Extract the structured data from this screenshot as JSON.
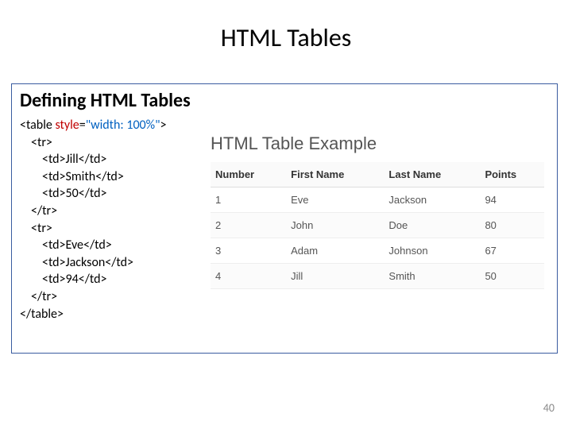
{
  "title": "HTML Tables",
  "section_heading": "Defining HTML Tables",
  "code": {
    "l1a": "<table ",
    "l1_attr": "style",
    "l1_eq": "=",
    "l1_val": "\"width: 100%\"",
    "l1b": ">",
    "l2": "<tr>",
    "l3": "<td>Jill</td>",
    "l4": "<td>Smith</td>",
    "l5": "<td>50</td>",
    "l6": "</tr>",
    "l7": "<tr>",
    "l8": "<td>Eve</td>",
    "l9": "<td>Jackson</td>",
    "l10": "<td>94</td>",
    "l11": "</tr>",
    "l12": "</table>"
  },
  "example": {
    "title": "HTML Table Example",
    "headers": {
      "h1": "Number",
      "h2": "First Name",
      "h3": "Last Name",
      "h4": "Points"
    },
    "rows": [
      {
        "c1": "1",
        "c2": "Eve",
        "c3": "Jackson",
        "c4": "94"
      },
      {
        "c1": "2",
        "c2": "John",
        "c3": "Doe",
        "c4": "80"
      },
      {
        "c1": "3",
        "c2": "Adam",
        "c3": "Johnson",
        "c4": "67"
      },
      {
        "c1": "4",
        "c2": "Jill",
        "c3": "Smith",
        "c4": "50"
      }
    ]
  },
  "page_number": "40"
}
